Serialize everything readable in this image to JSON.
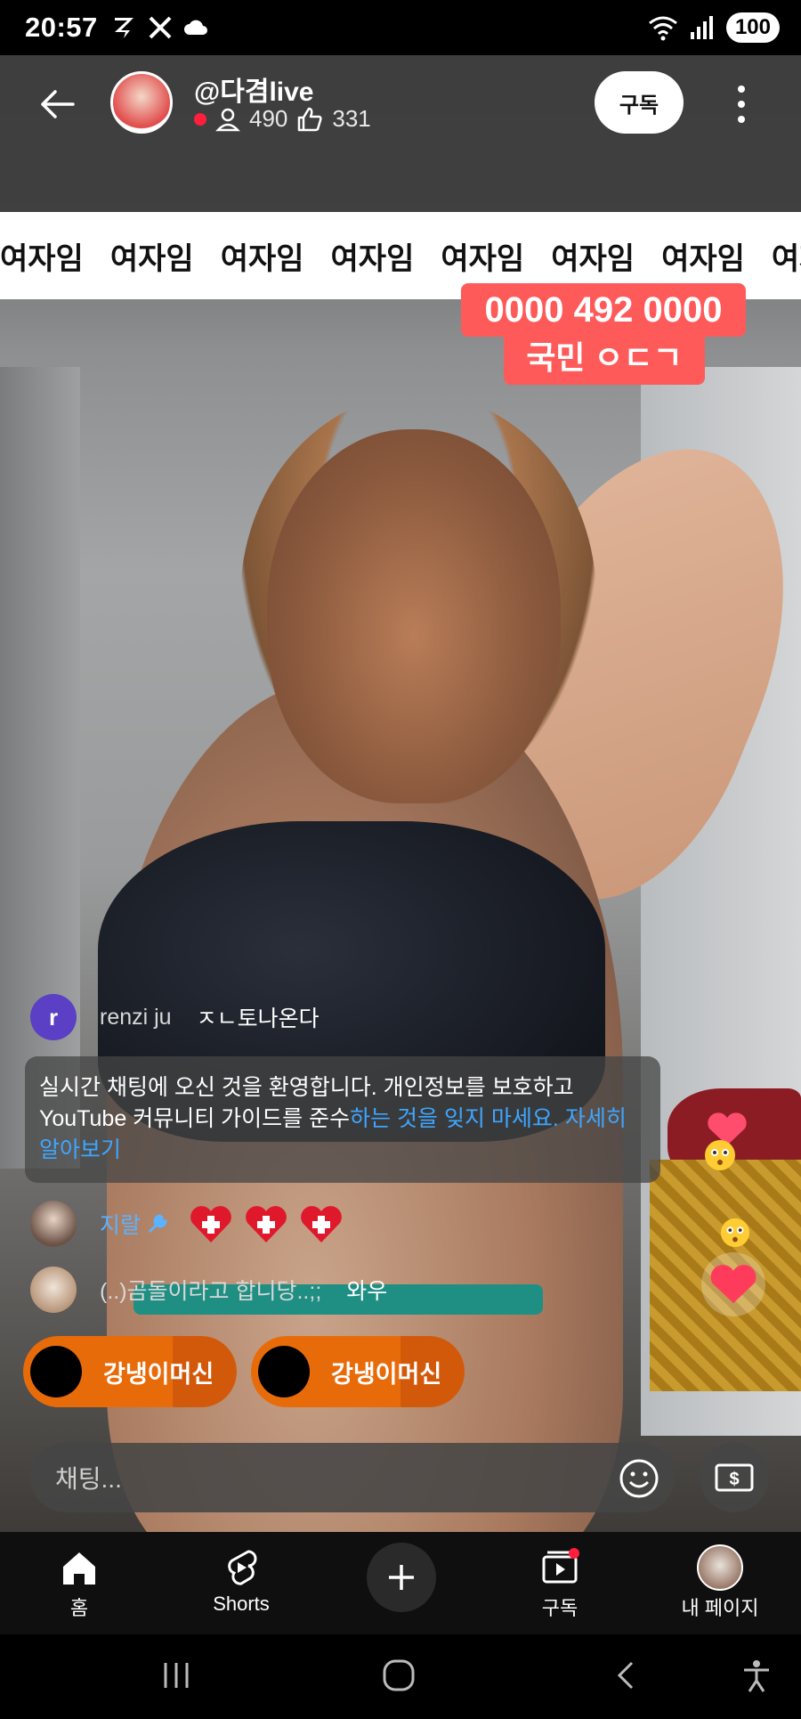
{
  "status_bar": {
    "time": "20:57",
    "battery": "100"
  },
  "channel": {
    "name": "@다겸live",
    "viewers": "490",
    "likes": "331",
    "subscribe_label": "구독"
  },
  "banner": {
    "words": [
      "여자임",
      "여자임",
      "여자임",
      "여자임",
      "여자임",
      "여자임",
      "여자임",
      "여자임"
    ]
  },
  "overlay": {
    "phone": "0000 492 0000",
    "nat": "국민 ㅇㄷㄱ"
  },
  "chat": {
    "messages": [
      {
        "avatar_letter": "r",
        "author": "renzi ju",
        "text": "ㅈㄴ토나온다"
      },
      {
        "author": "지랄"
      },
      {
        "author": "(..)곰돌이라고 합니당..;;",
        "text": "와우"
      }
    ],
    "welcome_text": "실시간 채팅에 오신 것을 환영합니다. 개인정보를 보호하고 YouTube 커뮤니티 가이드를 준수",
    "welcome_link": "하는 것을 잊지 마세요. 자세히 알아보기",
    "pills": [
      {
        "label": "강냉이머신"
      },
      {
        "label": "강냉이머신"
      }
    ],
    "input_placeholder": "채팅..."
  },
  "bottom_nav": {
    "items": [
      {
        "label": "홈",
        "icon": "home-icon"
      },
      {
        "label": "Shorts",
        "icon": "shorts-icon"
      },
      {
        "label": "",
        "icon": "plus-icon"
      },
      {
        "label": "구독",
        "icon": "subscriptions-icon"
      },
      {
        "label": "내 페이지",
        "icon": "profile-icon"
      }
    ]
  },
  "colors": {
    "accent_red": "#ff5a5a",
    "pill_orange": "#e86b0a",
    "link_blue": "#3ea6ff",
    "live_red": "#ff1e3c"
  }
}
